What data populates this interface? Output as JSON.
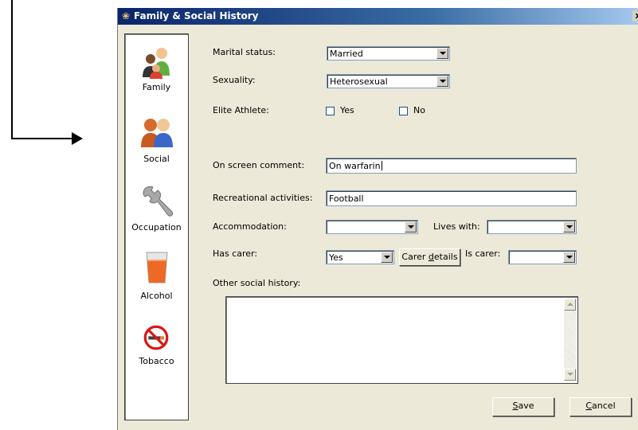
{
  "window": {
    "title": "Family & Social History",
    "close_label": "x"
  },
  "nav": {
    "items": [
      {
        "label": "Family",
        "icon": "family-icon"
      },
      {
        "label": "Social",
        "icon": "social-icon"
      },
      {
        "label": "Occupation",
        "icon": "wrench-icon"
      },
      {
        "label": "Alcohol",
        "icon": "alcohol-glass-icon"
      },
      {
        "label": "Tobacco",
        "icon": "no-smoking-icon"
      }
    ]
  },
  "form": {
    "marital_status": {
      "label": "Marital status:",
      "value": "Married"
    },
    "sexuality": {
      "label": "Sexuality:",
      "value": "Heterosexual"
    },
    "elite_athlete": {
      "label": "Elite Athlete:",
      "yes_label": "Yes",
      "no_label": "No",
      "yes_checked": false,
      "no_checked": false
    },
    "on_screen_comment": {
      "label": "On screen comment:",
      "value": "On warfarin"
    },
    "recreational_activities": {
      "label": "Recreational activities:",
      "value": "Football"
    },
    "accommodation": {
      "label": "Accommodation:",
      "value": ""
    },
    "lives_with": {
      "label": "Lives with:",
      "value": ""
    },
    "has_carer": {
      "label": "Has  carer:",
      "value": "Yes"
    },
    "carer_details_button": {
      "label": "Carer details",
      "accesskey": "d"
    },
    "is_carer": {
      "label": "Is carer:",
      "value": ""
    },
    "other_social_history": {
      "label": "Other social history:",
      "value": ""
    }
  },
  "buttons": {
    "save": "Save",
    "cancel": "Cancel"
  },
  "colors": {
    "titlebar_start": "#0a246a",
    "titlebar_end": "#a6caf0",
    "dialog_bg": "#ece9d8"
  }
}
